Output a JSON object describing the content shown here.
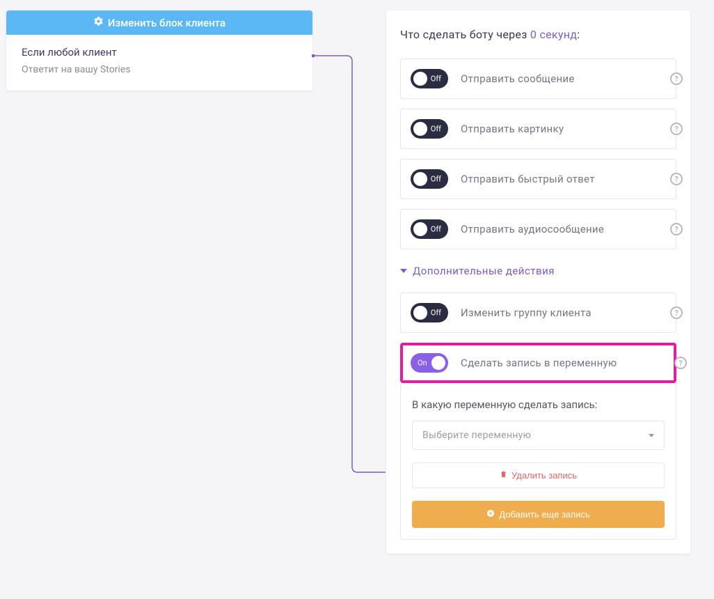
{
  "left": {
    "edit_button_label": "Изменить блок клиента",
    "line1": "Если любой клиент",
    "line2": "Ответит на вашу Stories"
  },
  "right": {
    "title_prefix": "Что сделать боту через ",
    "title_seconds": "0 секунд",
    "title_suffix": ":",
    "additional_header": "Дополнительные действия",
    "actions": [
      {
        "label": "Отправить сообщение",
        "state": "Off",
        "on": false
      },
      {
        "label": "Отправить картинку",
        "state": "Off",
        "on": false
      },
      {
        "label": "Отправить быстрый ответ",
        "state": "Off",
        "on": false
      },
      {
        "label": "Отправить аудиосообщение",
        "state": "Off",
        "on": false
      },
      {
        "label": "Изменить группу клиента",
        "state": "Off",
        "on": false
      },
      {
        "label": "Сделать запись в переменную",
        "state": "On",
        "on": true
      }
    ],
    "variable_section": {
      "label": "В какую переменную сделать запись:",
      "select_placeholder": "Выберите переменную",
      "delete_label": "Удалить запись",
      "add_label": "Добавить еще запись"
    },
    "help_char": "?"
  }
}
